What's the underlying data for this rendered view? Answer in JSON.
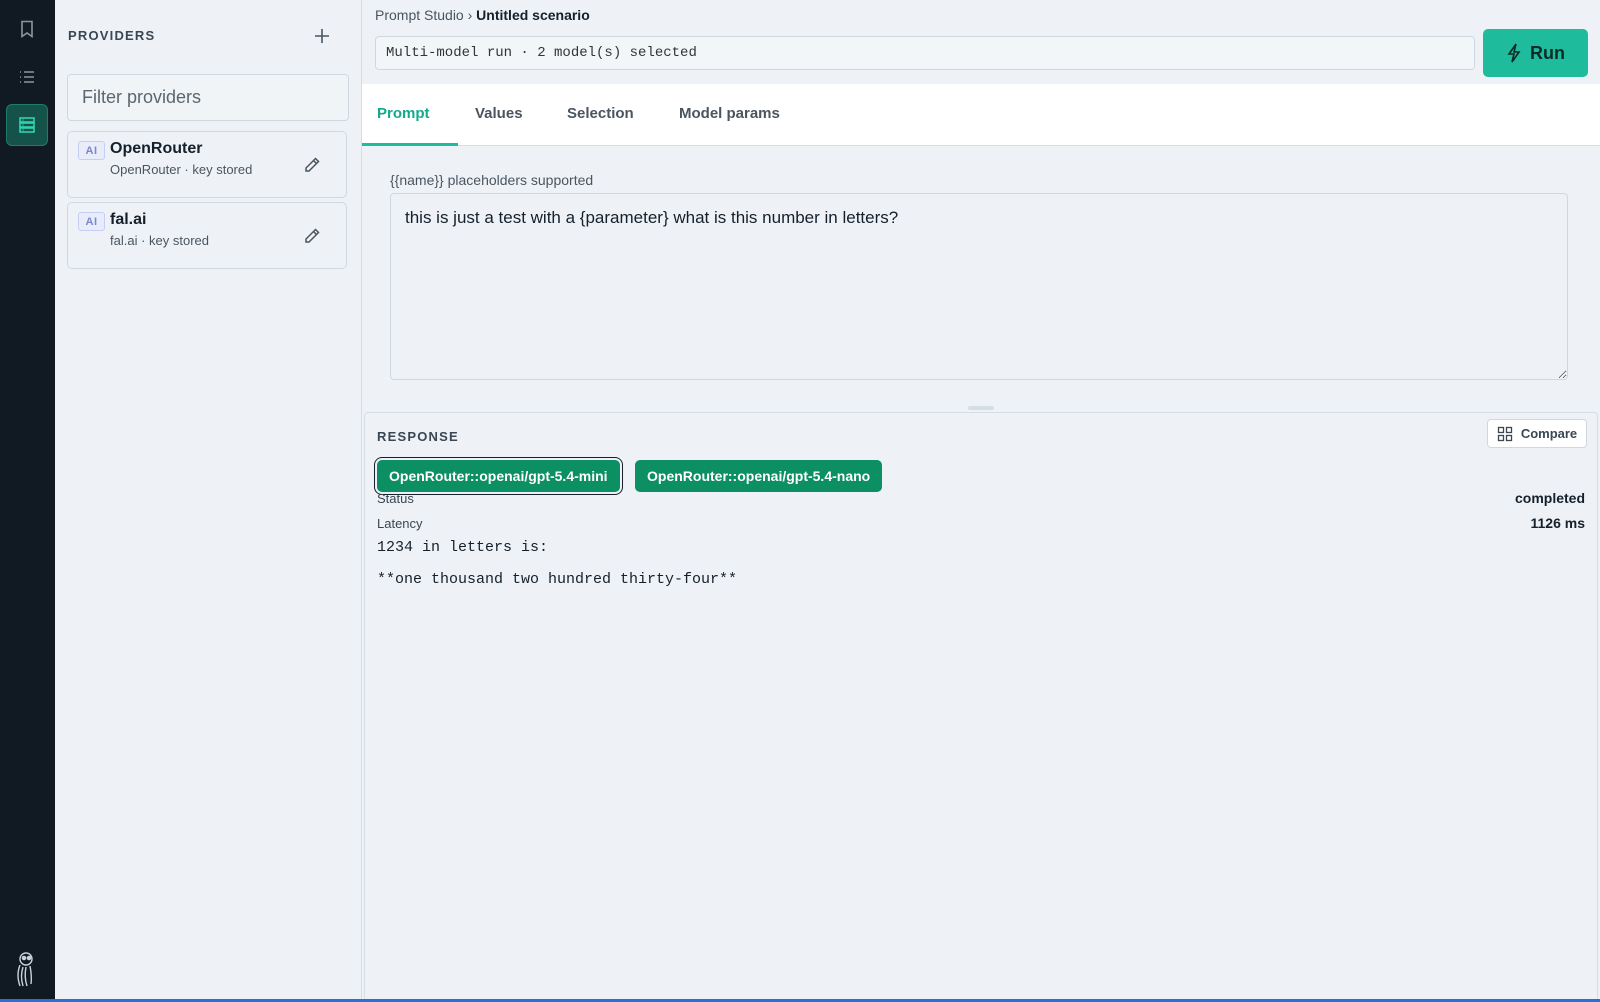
{
  "breadcrumb": {
    "root": "Prompt Studio",
    "separator": "›",
    "current": "Untitled scenario"
  },
  "run": {
    "summary": "Multi-model run · 2 model(s) selected",
    "button_label": "Run"
  },
  "providers": {
    "heading": "PROVIDERS",
    "filter_placeholder": "Filter providers",
    "items": [
      {
        "badge": "AI",
        "name": "OpenRouter",
        "subtitle": "OpenRouter · key stored"
      },
      {
        "badge": "AI",
        "name": "fal.ai",
        "subtitle": "fal.ai · key stored"
      }
    ]
  },
  "tabs": [
    {
      "label": "Prompt",
      "active": true
    },
    {
      "label": "Values",
      "active": false
    },
    {
      "label": "Selection",
      "active": false
    },
    {
      "label": "Model params",
      "active": false
    }
  ],
  "prompt": {
    "hint": "{{name}} placeholders supported",
    "text": "this is just a test with a {parameter} what is this number in letters?"
  },
  "response": {
    "heading": "RESPONSE",
    "compare_label": "Compare",
    "models": [
      {
        "label": "OpenRouter::openai/gpt-5.4-mini",
        "selected": true
      },
      {
        "label": "OpenRouter::openai/gpt-5.4-nano",
        "selected": false
      }
    ],
    "status_label": "Status",
    "status_value": "completed",
    "latency_label": "Latency",
    "latency_value": "1126 ms",
    "output_lines": [
      "1234 in letters is:",
      "**one thousand two hundred thirty-four**"
    ]
  },
  "colors": {
    "accent": "#1ebc9c",
    "chip": "#0d8f64",
    "rail": "#111a22"
  },
  "icons": {
    "rail": [
      "bookmark-icon",
      "list-icon",
      "database-icon"
    ],
    "add": "plus-icon",
    "edit": "pencil-icon",
    "run": "lightning-icon",
    "compare": "grid-icon",
    "logo": "owl-logo-icon"
  }
}
